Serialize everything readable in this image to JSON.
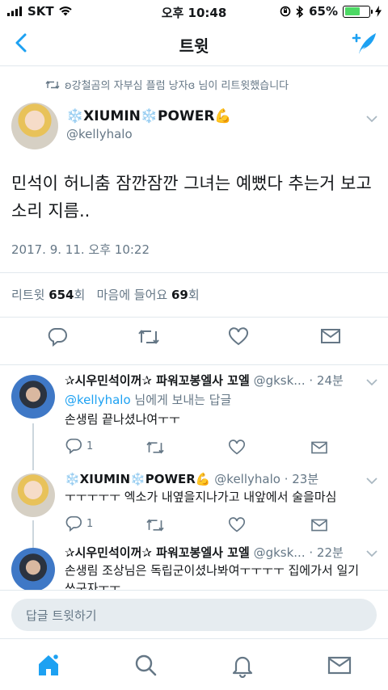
{
  "status_bar": {
    "carrier": "SKT",
    "time": "오후 10:48",
    "battery": "65%",
    "battery_level": 0.65
  },
  "nav": {
    "title": "트윗"
  },
  "retweet_notice": "ʚ강철곰의 자부심 플럼 낭자ɞ 님이 리트윗했습니다",
  "tweet": {
    "display_name": "❄️XIUMIN❄️POWER💪",
    "handle": "@kellyhalo",
    "text": "민석이 허니춤 잠깐잠깐 그녀는 예뻤다 추는거 보고 소리 지름..",
    "date": "2017. 9. 11. 오후 10:22",
    "retweets_label": "리트윗",
    "retweets_count": "654",
    "retweets_unit": "회",
    "likes_label": "마음에 들어요",
    "likes_count": "69",
    "likes_unit": "회"
  },
  "replies": [
    {
      "name": "✰시우민석이꺼✰ 파워꼬봉엘사 꼬엘",
      "handle": "@gksk...",
      "time": "· 24분",
      "reply_to_handle": "@kellyhalo",
      "reply_to_suffix": " 님에게 보내는 답글",
      "text": "손생림 끝나셨나여ㅜㅜ",
      "reply_count": "1"
    },
    {
      "name": "❄️XIUMIN❄️POWER💪",
      "handle": "@kellyhalo",
      "time": "· 23분",
      "text": "ㅜㅜㅜㅜㅜ 엑소가 내옆을지나가고 내앞에서 술을마심",
      "reply_count": "1"
    },
    {
      "name": "✰시우민석이꺼✰ 파워꼬봉엘사 꼬엘",
      "handle": "@gksk...",
      "time": "· 22분",
      "text": "손생림 조상님은 독립군이셨나봐여ㅜㅜㅜㅜ 집에가서 일기쓰구자ㅜㅜ"
    }
  ],
  "reply_input": {
    "placeholder": "답글 트윗하기"
  },
  "icons": {
    "back": "chevron-left-icon",
    "compose": "compose-tweet-icon",
    "reply": "reply-icon",
    "retweet": "retweet-icon",
    "like": "heart-icon",
    "dm": "envelope-icon",
    "home": "home-icon",
    "search": "search-icon",
    "notifications": "bell-icon",
    "messages": "envelope-icon"
  },
  "colors": {
    "accent": "#1da1f2",
    "muted": "#657786",
    "text": "#14171a",
    "divider": "#e1e8ed"
  }
}
